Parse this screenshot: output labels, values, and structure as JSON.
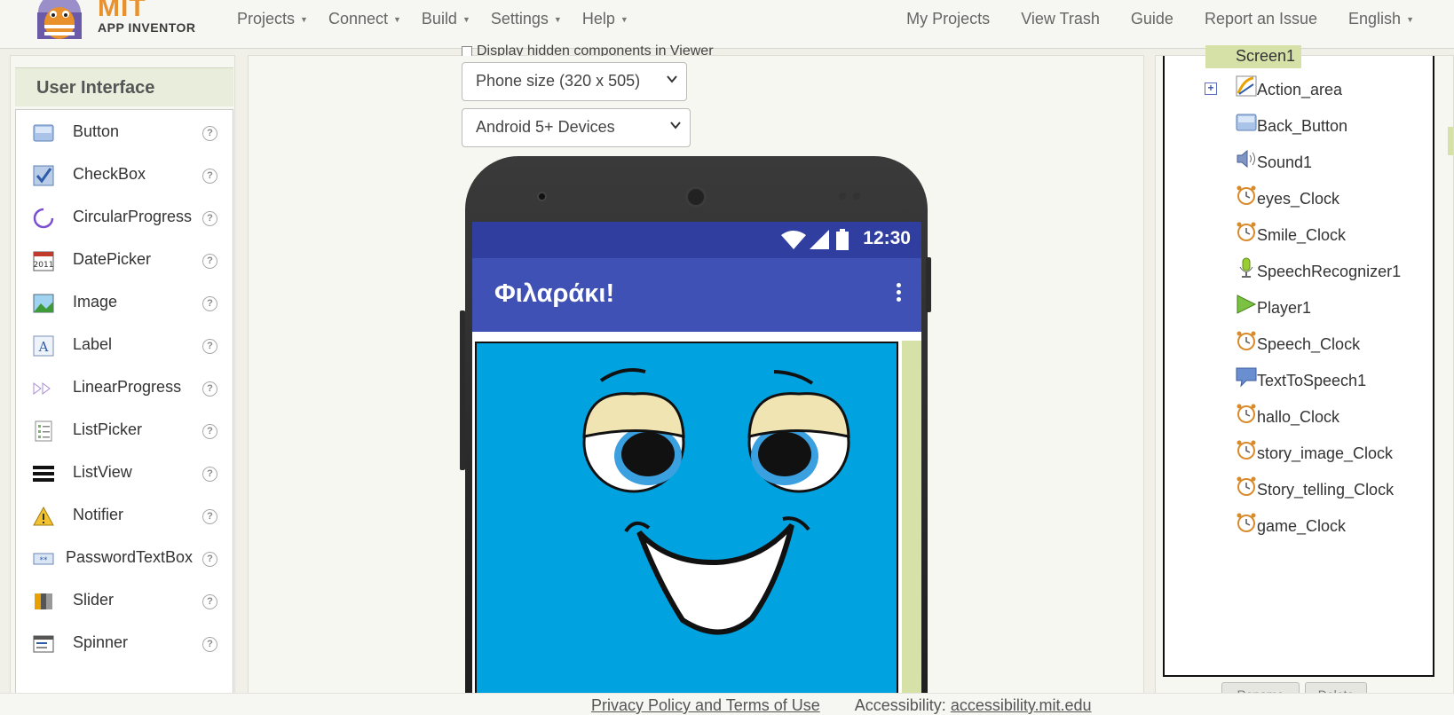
{
  "header": {
    "logo_title": "MIT",
    "logo_subtitle": "APP INVENTOR",
    "menus": [
      "Projects",
      "Connect",
      "Build",
      "Settings",
      "Help"
    ],
    "right_links": [
      "My Projects",
      "View Trash",
      "Guide",
      "Report an Issue",
      "English"
    ]
  },
  "palette": {
    "title": "User Interface",
    "help_glyph": "?",
    "items": [
      {
        "label": "Button",
        "icon": "button-icon"
      },
      {
        "label": "CheckBox",
        "icon": "checkbox-icon"
      },
      {
        "label": "CircularProgress",
        "icon": "circular-progress-icon"
      },
      {
        "label": "DatePicker",
        "icon": "datepicker-icon"
      },
      {
        "label": "Image",
        "icon": "image-icon"
      },
      {
        "label": "Label",
        "icon": "label-icon"
      },
      {
        "label": "LinearProgress",
        "icon": "linear-progress-icon"
      },
      {
        "label": "ListPicker",
        "icon": "listpicker-icon"
      },
      {
        "label": "ListView",
        "icon": "listview-icon"
      },
      {
        "label": "Notifier",
        "icon": "notifier-icon"
      },
      {
        "label": "PasswordTextBox",
        "icon": "password-icon"
      },
      {
        "label": "Slider",
        "icon": "slider-icon"
      },
      {
        "label": "Spinner",
        "icon": "spinner-icon"
      }
    ]
  },
  "viewer": {
    "hidden_checkbox_label": "Display hidden components in Viewer",
    "phone_size": "Phone size (320 x 505)",
    "device_theme": "Android 5+ Devices",
    "status_time": "12:30",
    "app_title": "Φιλαράκι!"
  },
  "components": {
    "root": "Screen1",
    "expander_glyph": "+",
    "items": [
      {
        "label": "Action_area",
        "icon": "canvas-icon",
        "expandable": true
      },
      {
        "label": "Back_Button",
        "icon": "button-icon"
      },
      {
        "label": "Sound1",
        "icon": "sound-icon"
      },
      {
        "label": "eyes_Clock",
        "icon": "clock-icon"
      },
      {
        "label": "Smile_Clock",
        "icon": "clock-icon"
      },
      {
        "label": "SpeechRecognizer1",
        "icon": "speech-recognizer-icon"
      },
      {
        "label": "Player1",
        "icon": "player-icon"
      },
      {
        "label": "Speech_Clock",
        "icon": "clock-icon"
      },
      {
        "label": "TextToSpeech1",
        "icon": "text-to-speech-icon"
      },
      {
        "label": "hallo_Clock",
        "icon": "clock-icon"
      },
      {
        "label": "story_image_Clock",
        "icon": "clock-icon"
      },
      {
        "label": "Story_telling_Clock",
        "icon": "clock-icon"
      },
      {
        "label": "game_Clock",
        "icon": "clock-icon"
      }
    ],
    "buttons": [
      "Rename",
      "Delete"
    ]
  },
  "footer": {
    "privacy": "Privacy Policy and Terms of Use",
    "accessibility_label": "Accessibility:",
    "accessibility_link": "accessibility.mit.edu"
  },
  "colors": {
    "accent_green": "#d6e1a7",
    "app_bar": "#3f51b5",
    "status_bar": "#303f9f",
    "canvas_bg": "#00a3e0",
    "logo_orange": "#e8912d"
  }
}
